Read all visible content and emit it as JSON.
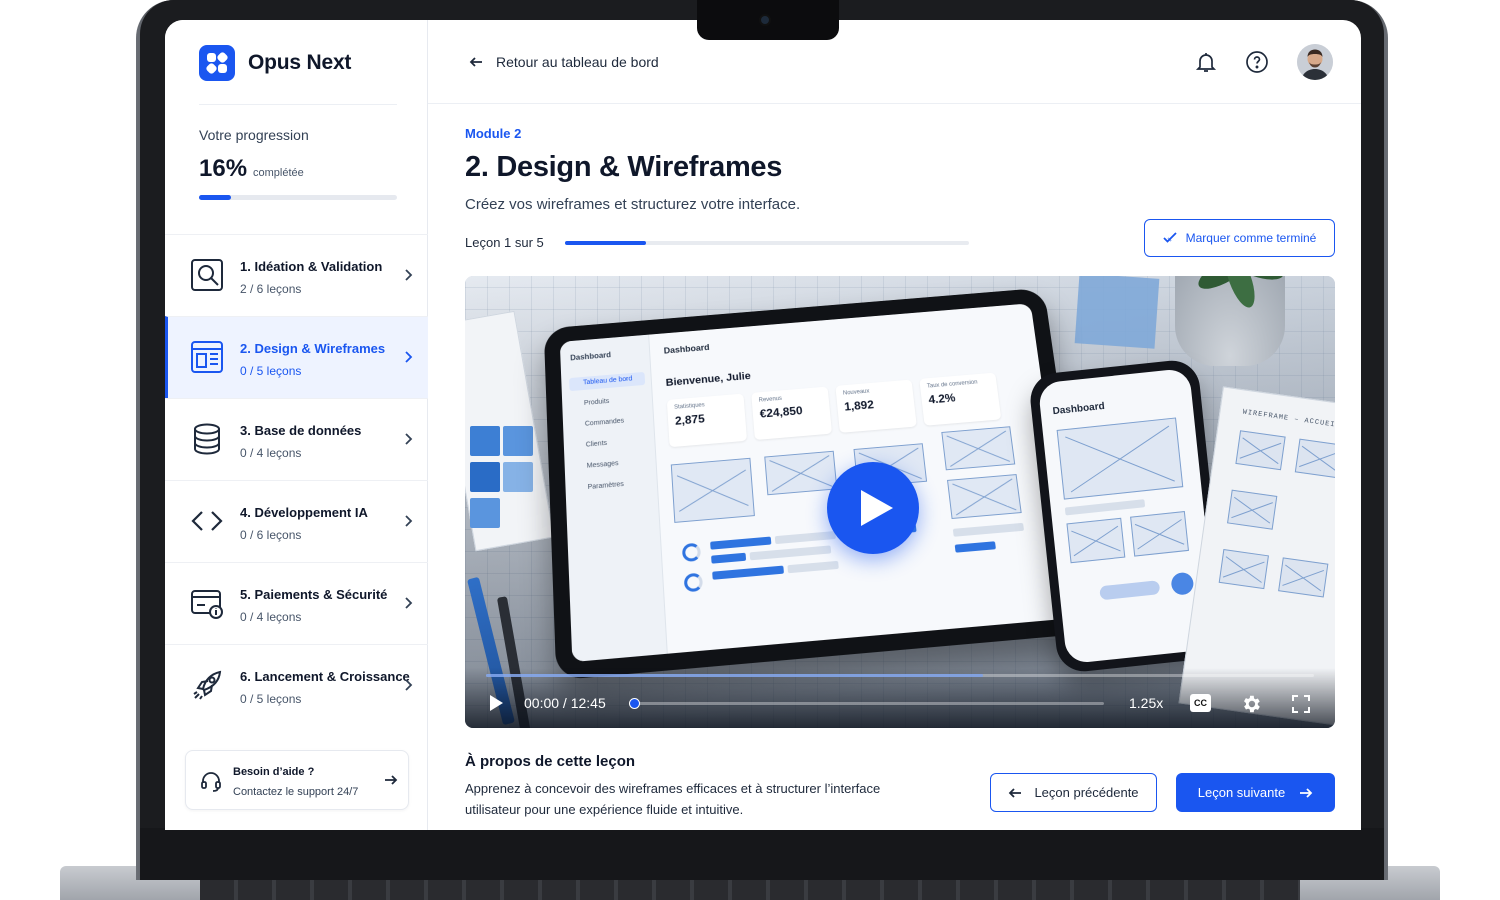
{
  "app": {
    "name": "Opus Next",
    "brand_color": "#1a56f0"
  },
  "progress": {
    "label": "Votre progression",
    "percent_text": "16%",
    "suffix": "complétée",
    "value": 0.16
  },
  "modules": [
    {
      "title": "1. Idéation & Validation",
      "lessons": "2 / 6 leçons",
      "icon": "search-document-icon",
      "active": false
    },
    {
      "title": "2. Design & Wireframes",
      "lessons": "0 / 5 leçons",
      "icon": "wireframe-icon",
      "active": true
    },
    {
      "title": "3. Base de données",
      "lessons": "0 / 4 leçons",
      "icon": "database-icon",
      "active": false
    },
    {
      "title": "4. Développement IA",
      "lessons": "0 / 6 leçons",
      "icon": "code-icon",
      "active": false
    },
    {
      "title": "5. Paiements & Sécurité",
      "lessons": "0 / 4 leçons",
      "icon": "card-lock-icon",
      "active": false
    },
    {
      "title": "6. Lancement & Croissance",
      "lessons": "0 / 5 leçons",
      "icon": "rocket-icon",
      "active": false
    }
  ],
  "help": {
    "title": "Besoin d’aide ?",
    "subtitle": "Contactez le support 24/7"
  },
  "topbar": {
    "back_label": "Retour au tableau de bord"
  },
  "lesson": {
    "module_label": "Module 2",
    "title": "2. Design & Wireframes",
    "subtitle": "Créez vos wireframes et structurez votre interface.",
    "count_label": "Leçon 1 sur 5",
    "progress": 0.2,
    "mark_done_label": "Marquer comme terminé"
  },
  "video": {
    "time": "00:00 / 12:45",
    "speed": "1.25x",
    "cc_label": "CC",
    "preview": {
      "tablet_title": "Dashboard",
      "welcome": "Bienvenue, Julie",
      "nav": [
        "Dashboard",
        "Tableau de bord",
        "Produits",
        "Commandes",
        "Clients",
        "Messages",
        "Paramètres"
      ],
      "stats": [
        {
          "label": "Statistiques",
          "value": "2,875"
        },
        {
          "label": "Revenus",
          "value": "€24,850"
        },
        {
          "label": "Nouveaux",
          "value": "1,892"
        },
        {
          "label": "Taux de conversion",
          "value": "4.2%"
        }
      ],
      "phone_title": "Dashboard",
      "notebook_title": "WIREFRAME – ACCUEIL"
    }
  },
  "about": {
    "title": "À propos de cette leçon",
    "text": "Apprenez à concevoir des wireframes efficaces et à structurer l’interface utilisateur pour une expérience fluide et intuitive."
  },
  "nav_buttons": {
    "prev": "Leçon précédente",
    "next": "Leçon suivante"
  }
}
